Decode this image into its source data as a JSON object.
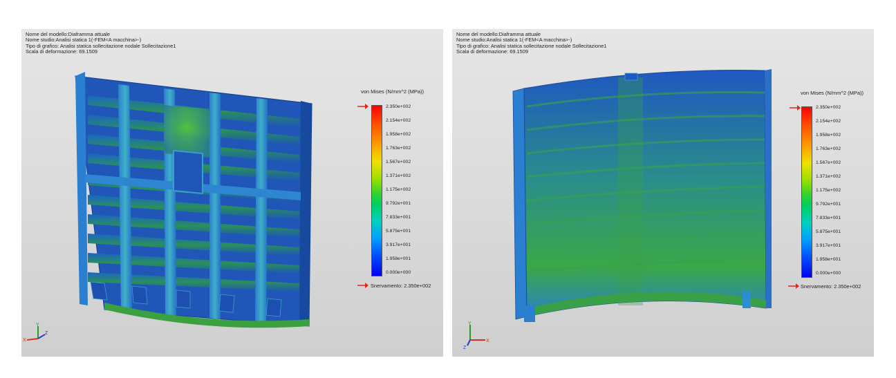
{
  "left": {
    "info": {
      "line1": "Nome del modello:Diaframma attuale",
      "line2": "Nome studio:Analisi statica 1(-FEM<A macchina>-)",
      "line3": "Tipo di grafico: Analisi statica sollecitazione nodale Sollecitazione1",
      "line4": "Scala di deformazione: 69.1509"
    },
    "legend": {
      "title": "von Mises (N/mm^2 (MPa))",
      "ticks": [
        "2.350e+002",
        "2.154e+002",
        "1.958e+002",
        "1.763e+002",
        "1.567e+002",
        "1.371e+002",
        "1.175e+002",
        "9.792e+001",
        "7.833e+001",
        "5.875e+001",
        "3.917e+001",
        "1.958e+001",
        "0.000e+000"
      ],
      "yield": "Snervamento: 2.350e+002"
    },
    "triad": {
      "x": "X",
      "y": "Y",
      "z": "Z"
    }
  },
  "right": {
    "info": {
      "line1": "Nome del modello:Diaframma attuale",
      "line2": "Nome studio:Analisi statica 1(-FEM<A macchina>-)",
      "line3": "Tipo di grafico: Analisi statica sollecitazione nodale Sollecitazione1",
      "line4": "Scala di deformazione: 69.1509"
    },
    "legend": {
      "title": "von Mises (N/mm^2 (MPa))",
      "ticks": [
        "2.350e+002",
        "2.154e+002",
        "1.958e+002",
        "1.763e+002",
        "1.567e+002",
        "1.371e+002",
        "1.175e+002",
        "9.792e+001",
        "7.833e+001",
        "5.875e+001",
        "3.917e+001",
        "1.958e+001",
        "0.000e+000"
      ],
      "yield": "Snervamento: 2.350e+002"
    },
    "triad": {
      "x": "X",
      "y": "Y",
      "z": "Z"
    }
  },
  "colors": {
    "arrow": "#e8241c",
    "steel_blue": "#1a4fb0",
    "stress_green": "#3aa040"
  }
}
